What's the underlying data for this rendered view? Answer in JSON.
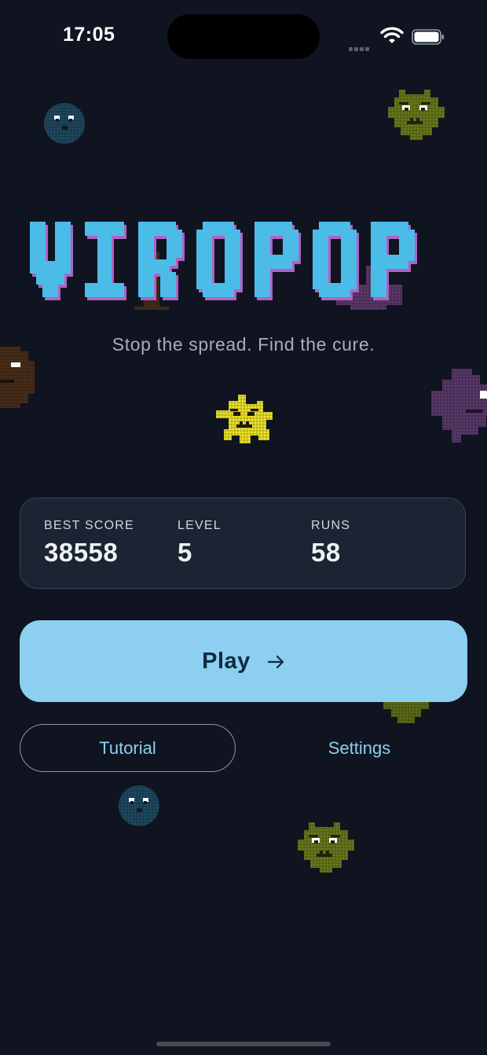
{
  "status_bar": {
    "time": "17:05"
  },
  "game": {
    "title": "VIROPOP",
    "tagline": "Stop the spread. Find the cure.",
    "colors": {
      "background": "#0f1420",
      "title": "#4bbce8",
      "title_shadow": "#b062c4",
      "accent": "#8ccff0"
    }
  },
  "stats": [
    {
      "label": "BEST SCORE",
      "value": "38558"
    },
    {
      "label": "LEVEL",
      "value": "5"
    },
    {
      "label": "RUNS",
      "value": "58"
    }
  ],
  "actions": {
    "play_label": "Play",
    "play_icon": "arrow-right-icon",
    "tutorial_label": "Tutorial",
    "settings_label": "Settings"
  },
  "viruses": [
    {
      "kind": "round-blue-virus",
      "color": "#1f4a63"
    },
    {
      "kind": "spiky-olive-virus",
      "color": "#6b7a1c"
    },
    {
      "kind": "round-brown-virus",
      "color": "#4a2f1a"
    },
    {
      "kind": "blob-purple-virus",
      "color": "#5d3a6e"
    },
    {
      "kind": "blob-purple-virus",
      "color": "#5a3a6b"
    },
    {
      "kind": "star-yellow-virus",
      "color": "#f2e82a"
    },
    {
      "kind": "spiky-olive-virus",
      "color": "#5f6d1a"
    },
    {
      "kind": "round-blue-virus",
      "color": "#1f4a63"
    },
    {
      "kind": "spiky-olive-virus",
      "color": "#6b7a1c"
    }
  ]
}
